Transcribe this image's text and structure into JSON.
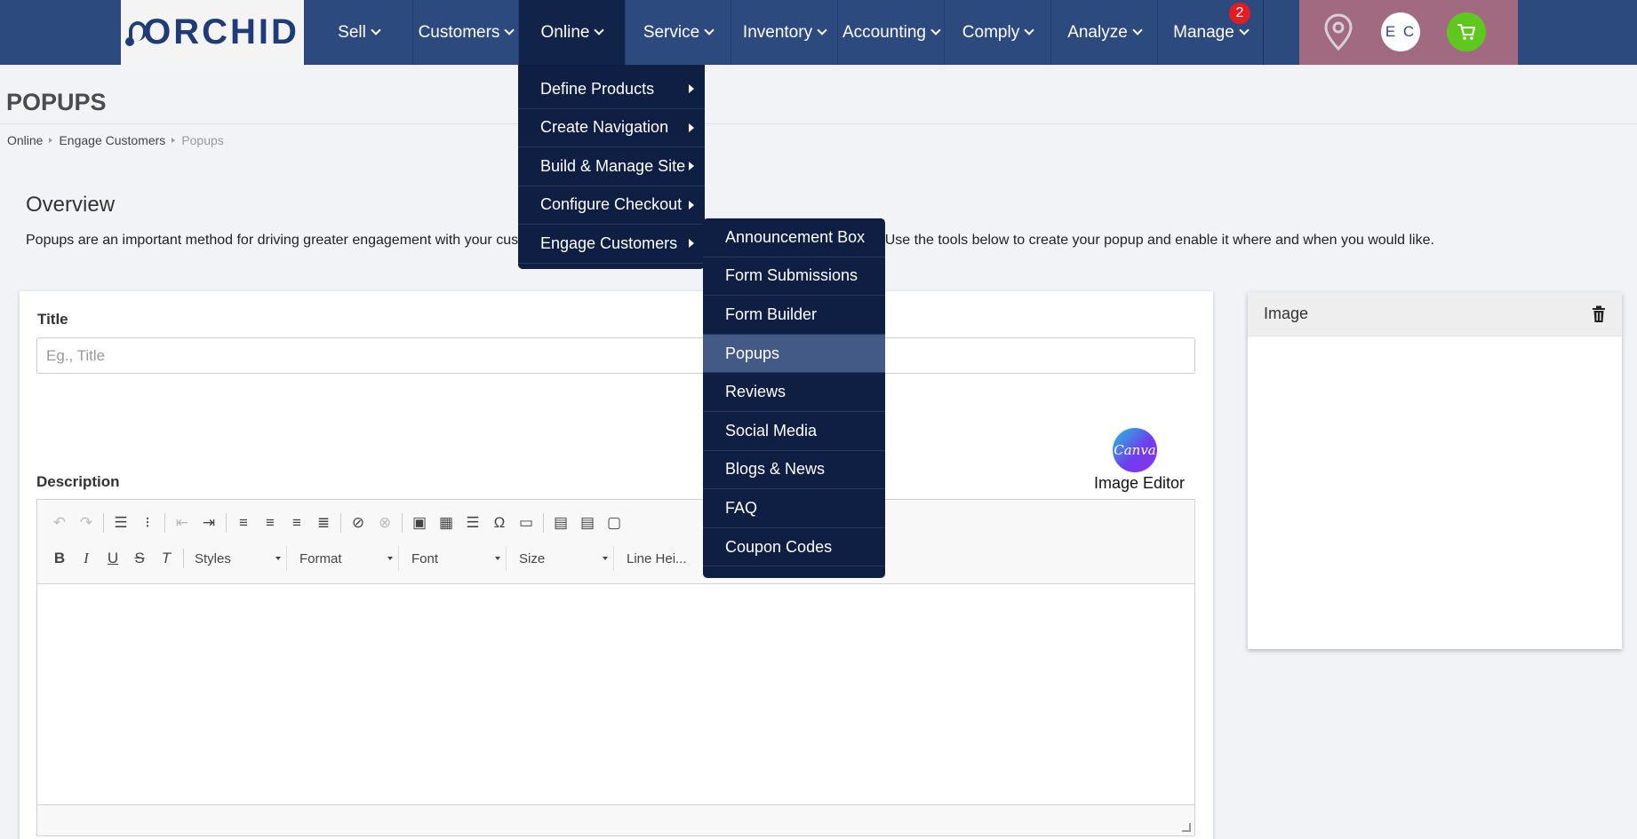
{
  "logo": {
    "text": "ORCHID"
  },
  "nav": {
    "items": [
      {
        "label": "Sell"
      },
      {
        "label": "Customers"
      },
      {
        "label": "Online"
      },
      {
        "label": "Service"
      },
      {
        "label": "Inventory"
      },
      {
        "label": "Accounting"
      },
      {
        "label": "Comply"
      },
      {
        "label": "Analyze"
      },
      {
        "label": "Manage",
        "badge": "2"
      }
    ],
    "avatar_initials": "E C",
    "icons": [
      "map-pin-icon",
      "cart-icon"
    ]
  },
  "page": {
    "title": "POPUPS",
    "breadcrumb": [
      "Online",
      "Engage Customers",
      "Popups"
    ]
  },
  "overview": {
    "heading": "Overview",
    "text": "Popups are an important method for driving greater engagement with your customers to let them know about a sale, a product, or event. Use the tools below to create your popup and enable it where and when you would like."
  },
  "form": {
    "title_label": "Title",
    "title_placeholder": "Eg., Title",
    "description_label": "Description",
    "image_editor_label": "Image Editor",
    "canva_text": "Canva",
    "toolbar_combos": [
      "Styles",
      "Format",
      "Font",
      "Size",
      "Line Hei..."
    ]
  },
  "image_panel": {
    "title": "Image"
  },
  "menus": {
    "online": [
      {
        "label": "Define Products"
      },
      {
        "label": "Create Navigation"
      },
      {
        "label": "Build & Manage Site"
      },
      {
        "label": "Configure Checkout"
      },
      {
        "label": "Engage Customers"
      }
    ],
    "engage": [
      {
        "label": "Announcement Box"
      },
      {
        "label": "Form Submissions"
      },
      {
        "label": "Form Builder"
      },
      {
        "label": "Popups",
        "highlighted": true
      },
      {
        "label": "Reviews"
      },
      {
        "label": "Social Media"
      },
      {
        "label": "Blogs & News"
      },
      {
        "label": "FAQ"
      },
      {
        "label": "Coupon Codes"
      }
    ]
  },
  "colors": {
    "nav_bg": "#2c4a7e",
    "nav_active": "#112348",
    "menu_bg": "#0f1f44",
    "menu_highlight": "#425a85",
    "badge": "#e51b24",
    "cart": "#5fc81f"
  }
}
